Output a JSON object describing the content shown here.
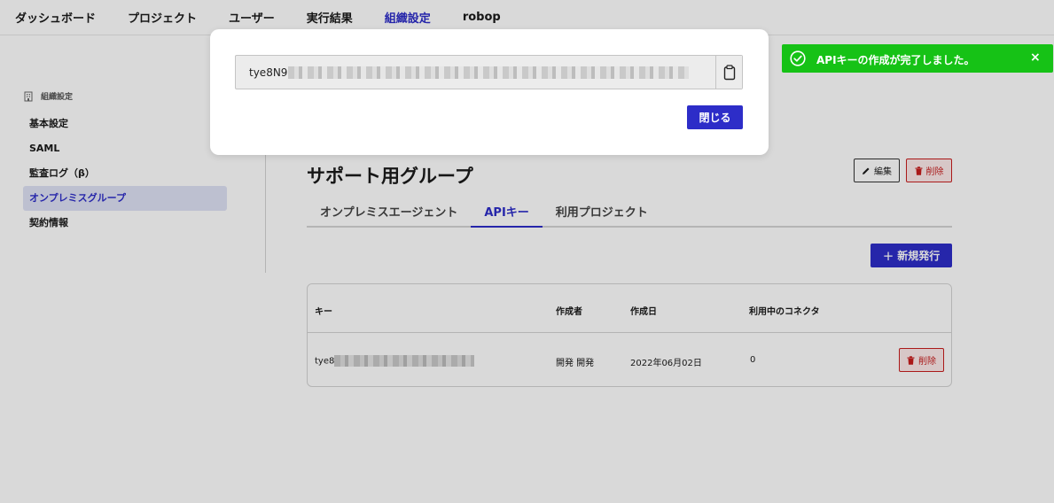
{
  "topnav": {
    "items": [
      "ダッシュボード",
      "プロジェクト",
      "ユーザー",
      "実行結果",
      "組織設定"
    ],
    "active": "組織設定",
    "user": "robop"
  },
  "sidebar": {
    "header": "組織設定",
    "header_icon": "building-icon",
    "items": [
      "基本設定",
      "SAML",
      "監査ログ（β）",
      "オンプレミスグループ",
      "契約情報"
    ],
    "active": "オンプレミスグループ"
  },
  "group": {
    "title": "サポート用グループ",
    "edit_label": "編集",
    "delete_label": "削除"
  },
  "tabs": [
    "オンプレミスエージェント",
    "APIキー",
    "利用プロジェクト"
  ],
  "active_tab": "APIキー",
  "new_button": {
    "plus": "+",
    "label": "新規発行"
  },
  "table": {
    "headers": [
      "キー",
      "作成者",
      "作成日",
      "利用中のコネクタ"
    ],
    "rows": [
      {
        "key_visible": "tye8",
        "creator": "開発 開発",
        "created": "2022年06月02日",
        "connectors": "0",
        "delete_label": "削除"
      }
    ]
  },
  "modal": {
    "key_visible": "tye8N9",
    "close_label": "閉じる"
  },
  "toast": {
    "message": "APIキーの作成が完了しました。",
    "close": "×",
    "color": "#16c216"
  },
  "colors": {
    "accent": "#2d2dc8",
    "danger": "#c81e1e",
    "success": "#16c216"
  }
}
